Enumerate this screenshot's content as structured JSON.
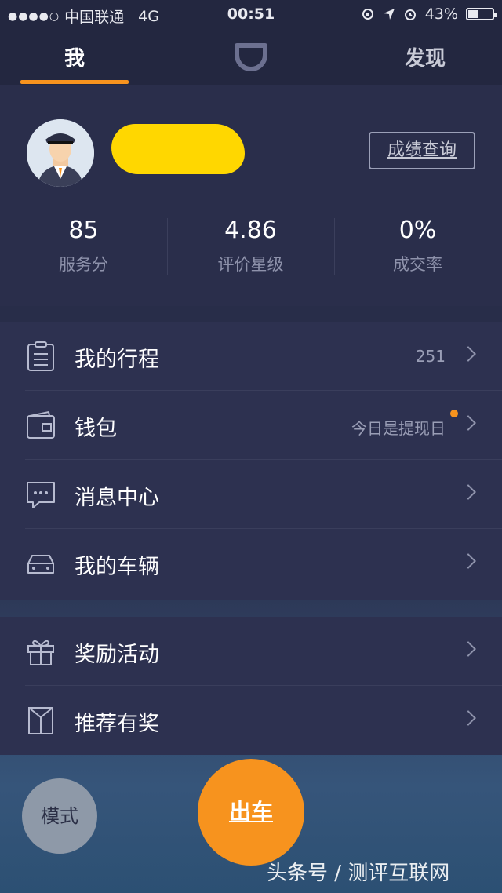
{
  "status_bar": {
    "signal_dots": "●●●●○",
    "carrier": "中国联通",
    "network": "4G",
    "time": "00:51",
    "battery_percent_text": "43%",
    "battery_level": 0.43
  },
  "tabs": {
    "me": "我",
    "discover": "发现"
  },
  "profile": {
    "score_query_label": "成绩查询",
    "stats": [
      {
        "value": "85",
        "label": "服务分"
      },
      {
        "value": "4.86",
        "label": "评价星级"
      },
      {
        "value": "0%",
        "label": "成交率"
      }
    ]
  },
  "menu_group_1": [
    {
      "label": "我的行程",
      "value": "251",
      "icon": "clipboard-icon"
    },
    {
      "label": "钱包",
      "value": "今日是提现日",
      "icon": "wallet-icon"
    },
    {
      "label": "消息中心",
      "value": "",
      "icon": "message-icon"
    },
    {
      "label": "我的车辆",
      "value": "",
      "icon": "car-icon"
    }
  ],
  "menu_group_2": [
    {
      "label": "奖励活动",
      "value": "",
      "icon": "gift-icon"
    },
    {
      "label": "推荐有奖",
      "value": "",
      "icon": "box-icon"
    }
  ],
  "buttons": {
    "mode": "模式",
    "go": "出车"
  },
  "watermark": "头条号 / 测评互联网",
  "colors": {
    "accent": "#f7931e",
    "background": "#2a2e4b",
    "name_mask": "#ffd700"
  }
}
